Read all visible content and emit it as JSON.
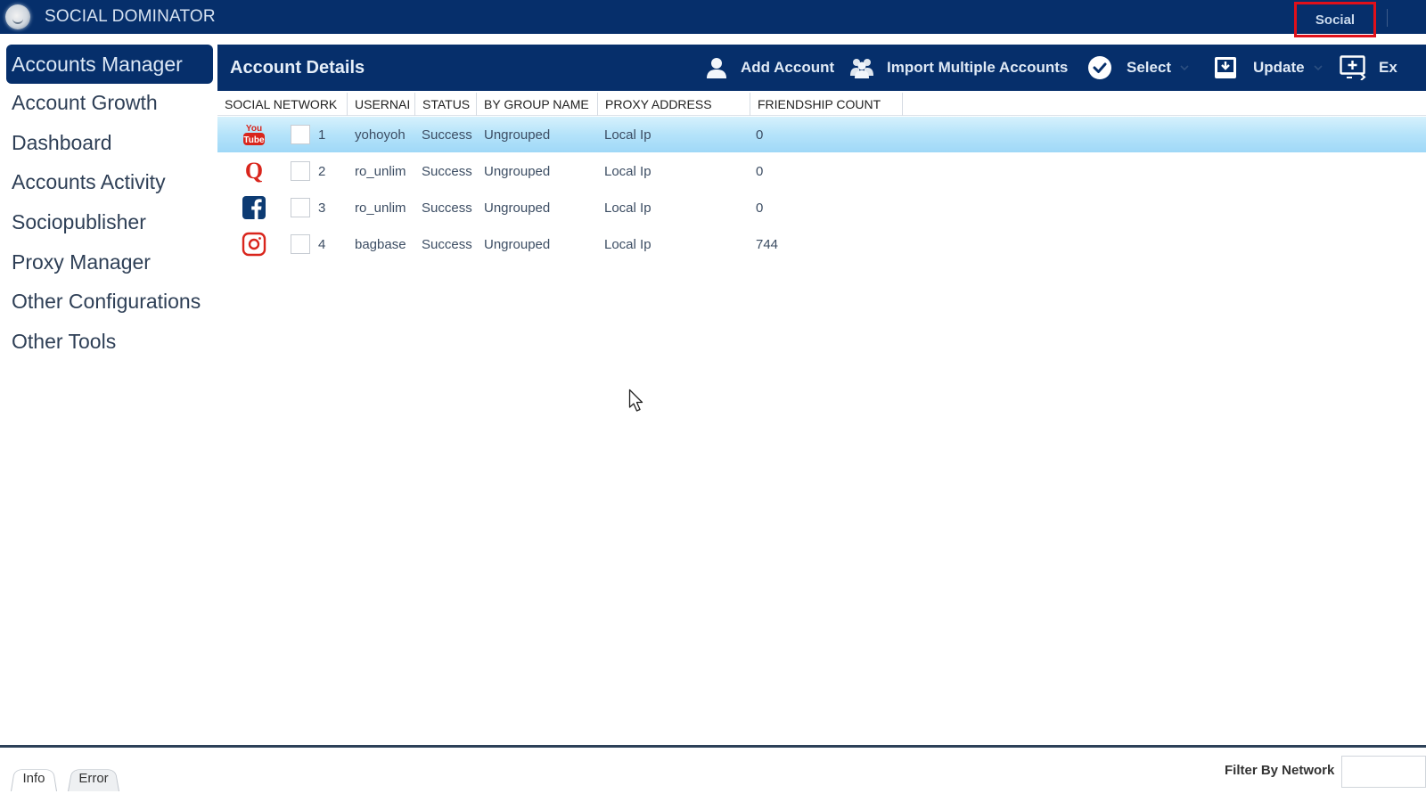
{
  "app": {
    "title": "SOCIAL DOMINATOR",
    "top_tab": "Social"
  },
  "sidebar": {
    "items": [
      {
        "label": "Accounts Manager",
        "active": true
      },
      {
        "label": "Account Growth"
      },
      {
        "label": "Dashboard"
      },
      {
        "label": "Accounts Activity"
      },
      {
        "label": "Sociopublisher"
      },
      {
        "label": "Proxy Manager"
      },
      {
        "label": "Other Configurations"
      },
      {
        "label": "Other Tools"
      }
    ]
  },
  "header": {
    "title": "Account Details",
    "toolbar": {
      "add_account": {
        "label": "Add Account",
        "icon": "user-icon"
      },
      "import_multiple": {
        "label": "Import Multiple Accounts",
        "icon": "users-icon"
      },
      "select": {
        "label": "Select",
        "icon": "check-circle-icon"
      },
      "update": {
        "label": "Update",
        "icon": "download-box-icon"
      },
      "export": {
        "label": "Ex",
        "icon": "export-screen-icon"
      }
    }
  },
  "table": {
    "columns": [
      "SOCIAL NETWORK",
      "USERNAI",
      "STATUS",
      "BY GROUP NAME",
      "PROXY ADDRESS",
      "FRIENDSHIP COUNT"
    ],
    "rows": [
      {
        "network": "YouTube",
        "icon": "youtube-icon",
        "index": "1",
        "username": "yohoyoh",
        "status": "Success",
        "group": "Ungrouped",
        "proxy": "Local Ip",
        "friendship_count": "0",
        "selected": true
      },
      {
        "network": "Quora",
        "icon": "quora-icon",
        "index": "2",
        "username": "ro_unlim",
        "status": "Success",
        "group": "Ungrouped",
        "proxy": "Local Ip",
        "friendship_count": "0"
      },
      {
        "network": "Facebook",
        "icon": "facebook-icon",
        "index": "3",
        "username": "ro_unlim",
        "status": "Success",
        "group": "Ungrouped",
        "proxy": "Local Ip",
        "friendship_count": "0"
      },
      {
        "network": "Instagram",
        "icon": "instagram-icon",
        "index": "4",
        "username": "bagbase",
        "status": "Success",
        "group": "Ungrouped",
        "proxy": "Local Ip",
        "friendship_count": "744"
      }
    ]
  },
  "footer": {
    "tabs": [
      "Info",
      "Error"
    ],
    "filter_label": "Filter By Network",
    "filter_value": ""
  },
  "colors": {
    "brand_navy": "#062f6b",
    "selected_row": "#b5e3fa",
    "highlight_red": "#e0101a"
  }
}
